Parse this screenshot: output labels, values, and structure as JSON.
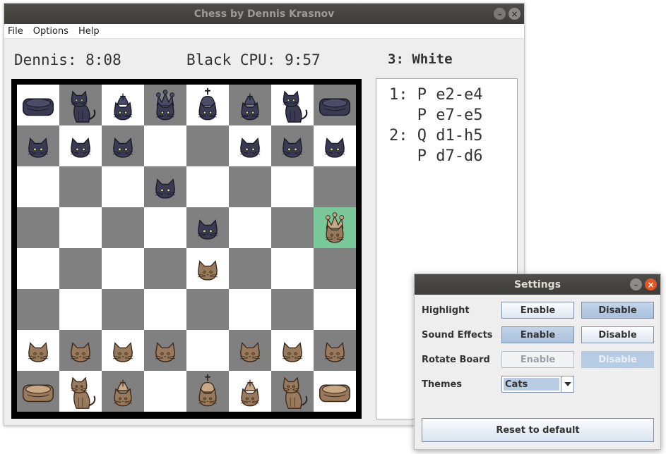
{
  "window": {
    "title": "Chess by Dennis Krasnov",
    "minimize_glyph": "–",
    "close_glyph": "×"
  },
  "menu": [
    "File",
    "Options",
    "Help"
  ],
  "status": {
    "white_clock": "Dennis: 8:08",
    "black_clock": "Black CPU: 9:57",
    "turn": "3: White"
  },
  "moves": [
    "1: P e2-e4",
    "   P e7-e5",
    "2: Q d1-h5",
    "   P d7-d6"
  ],
  "board": {
    "theme": "cats",
    "colors": {
      "light": "#ffffff",
      "dark": "#808080",
      "highlight": "#78c89a",
      "frame": "#000000"
    },
    "highlight_square": "h5",
    "rows": [
      [
        "bR",
        "bN",
        "bB",
        "bQ",
        "bK",
        "bB",
        "bN",
        "bR"
      ],
      [
        "bP",
        "bP",
        "bP",
        "",
        "",
        "bP",
        "bP",
        "bP"
      ],
      [
        "",
        "",
        "",
        "bP",
        "",
        "",
        "",
        ""
      ],
      [
        "",
        "",
        "",
        "",
        "bP",
        "",
        "",
        "wQ"
      ],
      [
        "",
        "",
        "",
        "",
        "wP",
        "",
        "",
        ""
      ],
      [
        "",
        "",
        "",
        "",
        "",
        "",
        "",
        ""
      ],
      [
        "wP",
        "wP",
        "wP",
        "wP",
        "",
        "wP",
        "wP",
        "wP"
      ],
      [
        "wR",
        "wN",
        "wB",
        "",
        "wK",
        "wB",
        "wN",
        "wR"
      ]
    ],
    "piece_icons": {
      "P": "cat-pawn-icon",
      "R": "cat-bed-rook-icon",
      "N": "sitting-cat-knight-icon",
      "B": "cat-bishop-icon",
      "Q": "cat-queen-icon",
      "K": "cat-king-icon"
    }
  },
  "settings": {
    "title": "Settings",
    "rows": [
      {
        "label": "Highlight",
        "enable": "Enable",
        "disable": "Disable"
      },
      {
        "label": "Sound Effects",
        "enable": "Enable",
        "disable": "Disable"
      },
      {
        "label": "Rotate Board",
        "enable": "Enable",
        "disable": "Disable"
      }
    ],
    "themes_label": "Themes",
    "theme_value": "Cats",
    "reset_label": "Reset to default"
  }
}
